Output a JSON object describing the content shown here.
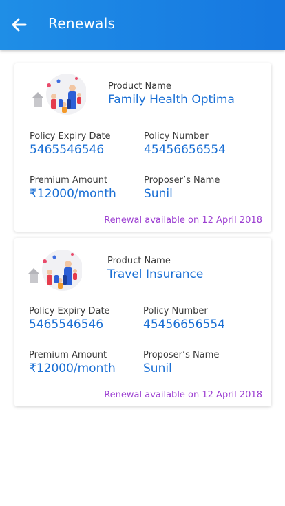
{
  "header": {
    "title": "Renewals",
    "back_icon": "arrow-left-icon",
    "bg_color": "#1a82e3"
  },
  "colors": {
    "value_text": "#1a6fd4",
    "renewal_note": "#9c3fd1"
  },
  "cards": [
    {
      "illustration": "family-illustration-icon",
      "product_label": "Product Name",
      "product_value": "Family Health Optima",
      "expiry_label": "Policy Expiry Date",
      "expiry_value": "5465546546",
      "number_label": "Policy Number",
      "number_value": "45456656554",
      "premium_label": "Premium Amount",
      "premium_value": "₹12000/month",
      "proposer_label": "Proposer’s Name",
      "proposer_value": "Sunil",
      "renewal_note": "Renewal available on 12 April 2018"
    },
    {
      "illustration": "family-illustration-icon",
      "product_label": "Product Name",
      "product_value": "Travel Insurance",
      "expiry_label": "Policy Expiry Date",
      "expiry_value": "5465546546",
      "number_label": "Policy Number",
      "number_value": "45456656554",
      "premium_label": "Premium Amount",
      "premium_value": "₹12000/month",
      "proposer_label": "Proposer’s Name",
      "proposer_value": "Sunil",
      "renewal_note": "Renewal available on 12 April 2018"
    }
  ]
}
